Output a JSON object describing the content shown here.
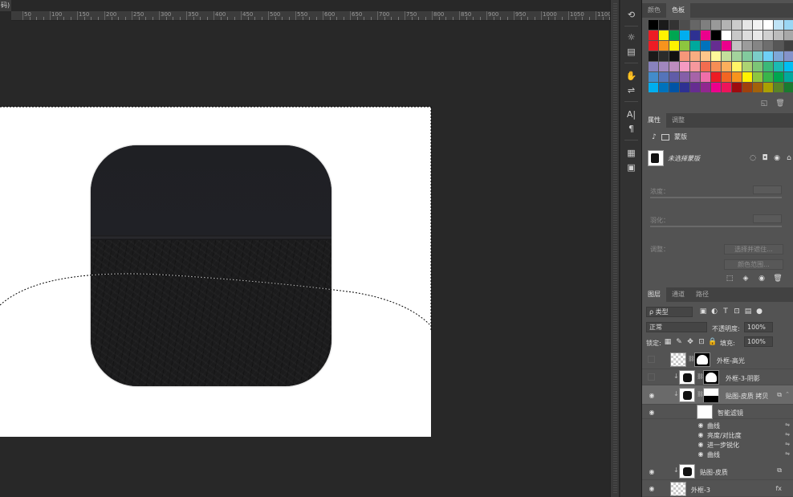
{
  "document": {
    "tab_label": "码) *"
  },
  "ruler": {
    "labels": [
      "50",
      "100",
      "150",
      "200",
      "250",
      "300",
      "350",
      "400",
      "450",
      "500",
      "550",
      "600",
      "650",
      "700",
      "750",
      "800",
      "850",
      "900",
      "950",
      "1000",
      "1050",
      "1100"
    ]
  },
  "tools": [
    {
      "name": "history-icon",
      "glyph": "⟲"
    },
    {
      "name": "adjustments-icon",
      "glyph": "☼"
    },
    {
      "name": "libraries-icon",
      "glyph": "▤"
    },
    {
      "name": "brush-presets-icon",
      "glyph": "✋"
    },
    {
      "name": "sliders-icon",
      "glyph": "⇌"
    },
    {
      "name": "character-icon",
      "glyph": "A|"
    },
    {
      "name": "paragraph-icon",
      "glyph": "¶"
    },
    {
      "name": "channels-panel-icon",
      "glyph": "▦"
    },
    {
      "name": "notes-icon",
      "glyph": "▣"
    }
  ],
  "color_panel": {
    "tabs": [
      "颜色",
      "色板"
    ],
    "active_tab": 1,
    "swatches": [
      "#000000",
      "#1a1a1a",
      "#333333",
      "#4d4d4d",
      "#666666",
      "#7f7f7f",
      "#999999",
      "#b3b3b3",
      "#cccccc",
      "#e6e6e6",
      "#f2f2f2",
      "#ffffff",
      "#bfe3f6",
      "#9ad6f4",
      "#ed1c24",
      "#fff200",
      "#00a651",
      "#00aeef",
      "#2e3192",
      "#ec008c",
      "#000000",
      "#ffffff",
      "#c8c8c8",
      "#dcdcdc",
      "#e8e8e8",
      "#d0d0d0",
      "#bcbcbc",
      "#a8a8a8",
      "#ed1c24",
      "#f7941d",
      "#fff200",
      "#8dc63f",
      "#00a99d",
      "#0072bc",
      "#662d91",
      "#ec008c",
      "#c2c2c2",
      "#9c9c9c",
      "#858585",
      "#6e6e6e",
      "#575757",
      "#404040",
      "#1a1a1a",
      "#2b2b2b",
      "#111111",
      "#f7977a",
      "#f9ad81",
      "#fdc68a",
      "#fff79a",
      "#c4df9b",
      "#a3d39c",
      "#82ca9d",
      "#7bcdc8",
      "#6ecff6",
      "#7ea7d8",
      "#8493ca",
      "#8882be",
      "#a187be",
      "#bc8dbf",
      "#f49ac2",
      "#f6989d",
      "#f26c4f",
      "#f68e55",
      "#fbaf5c",
      "#fff467",
      "#acd372",
      "#7cc576",
      "#3bb878",
      "#1abbb4",
      "#00bff3",
      "#438ccb",
      "#5574b9",
      "#605ca8",
      "#855fa8",
      "#a763a8",
      "#f06ea9",
      "#ed1c24",
      "#f26522",
      "#f7941d",
      "#fff200",
      "#8dc63f",
      "#39b54a",
      "#00a651",
      "#00a99d",
      "#00aeef",
      "#0072bc",
      "#0054a6",
      "#2e3192",
      "#662d91",
      "#92278f",
      "#ec008c",
      "#ed145b",
      "#9e0b0f",
      "#a0410d",
      "#a3620a",
      "#aba000",
      "#598527",
      "#197b30"
    ]
  },
  "properties_panel": {
    "tabs": [
      "属性",
      "调整"
    ],
    "active_tab": 0,
    "type_label": "蒙版",
    "mask_label": "未选择蒙版",
    "density_label": "浓度：",
    "feather_label": "羽化：",
    "refine_label": "调整：",
    "select_and_mask": "选择并遮住...",
    "color_range": "颜色范围..."
  },
  "layers_panel": {
    "tabs": [
      "图层",
      "通道",
      "路径"
    ],
    "active_tab": 0,
    "filter_kind": "ρ 类型",
    "blend_mode": "正常",
    "opacity_label": "不透明度:",
    "opacity_value": "100%",
    "lock_label": "锁定:",
    "fill_label": "填充:",
    "fill_value": "100%",
    "layers": [
      {
        "name": "外框-高光",
        "visible": false,
        "thumb": "checker",
        "mask": "mask",
        "clipped": false,
        "selected": false
      },
      {
        "name": "外框-3-阴影",
        "visible": false,
        "thumb": "dark",
        "mask": "mask",
        "clipped": true,
        "selected": false
      },
      {
        "name": "贴图-皮质 拷贝",
        "visible": true,
        "thumb": "dark",
        "mask": "halfmask",
        "clipped": true,
        "selected": true
      },
      {
        "name": "智能滤镜",
        "visible": true,
        "thumb": "plain",
        "mask": "",
        "clipped": false,
        "selected": false
      },
      {
        "name": "贴图-皮质",
        "visible": true,
        "thumb": "dark",
        "mask": "",
        "clipped": true,
        "selected": false
      },
      {
        "name": "外框-3",
        "visible": true,
        "thumb": "checker",
        "mask": "",
        "clipped": false,
        "selected": false
      }
    ],
    "filters": [
      "曲线",
      "亮度/对比度",
      "进一步锐化",
      "曲线"
    ],
    "fx_label": "fx"
  }
}
